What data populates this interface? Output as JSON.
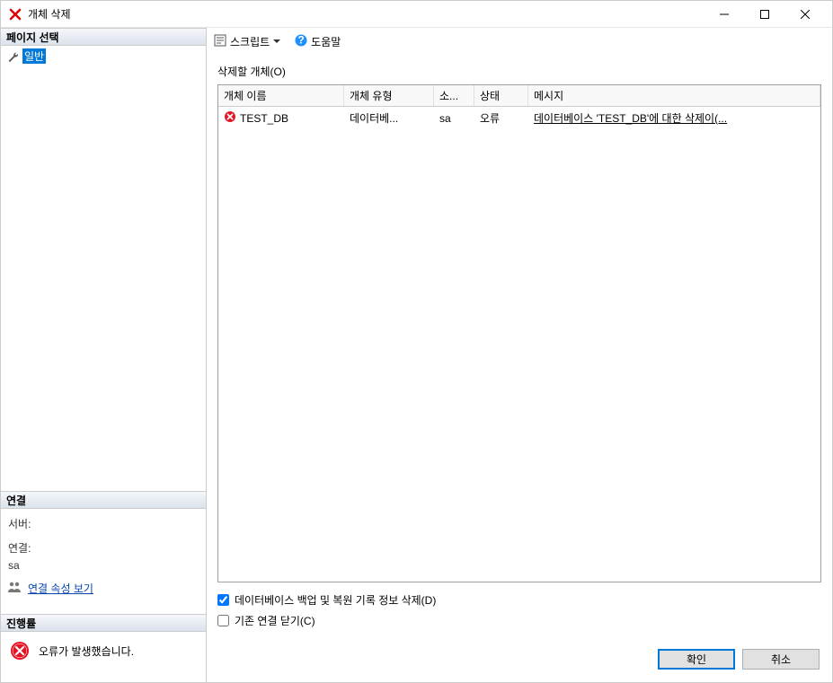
{
  "window": {
    "title": "개체 삭제"
  },
  "sidebar": {
    "page_select_header": "페이지 선택",
    "pages": [
      {
        "label": "일반"
      }
    ],
    "connection_header": "연결",
    "connection": {
      "server_label": "서버:",
      "server_value": "",
      "conn_label": "연결:",
      "conn_value": "sa",
      "view_props_link": "연결 속성 보기"
    },
    "progress_header": "진행률",
    "progress_text": "오류가 발생했습니다."
  },
  "toolbar": {
    "script_label": "스크립트",
    "help_label": "도움말"
  },
  "content": {
    "objects_label": "삭제할 개체(O)",
    "columns": {
      "name": "개체 이름",
      "type": "개체 유형",
      "owner": "소...",
      "status": "상태",
      "message": "메시지"
    },
    "rows": [
      {
        "name": "TEST_DB",
        "type": "데이터베...",
        "owner": "sa",
        "status": "오류",
        "message": "데이터베이스 'TEST_DB'에 대한 삭제이(..."
      }
    ],
    "checkbox1_label": "데이터베이스 백업 및 복원 기록 정보 삭제(D)",
    "checkbox2_label": "기존 연결 닫기(C)"
  },
  "footer": {
    "ok": "확인",
    "cancel": "취소"
  }
}
